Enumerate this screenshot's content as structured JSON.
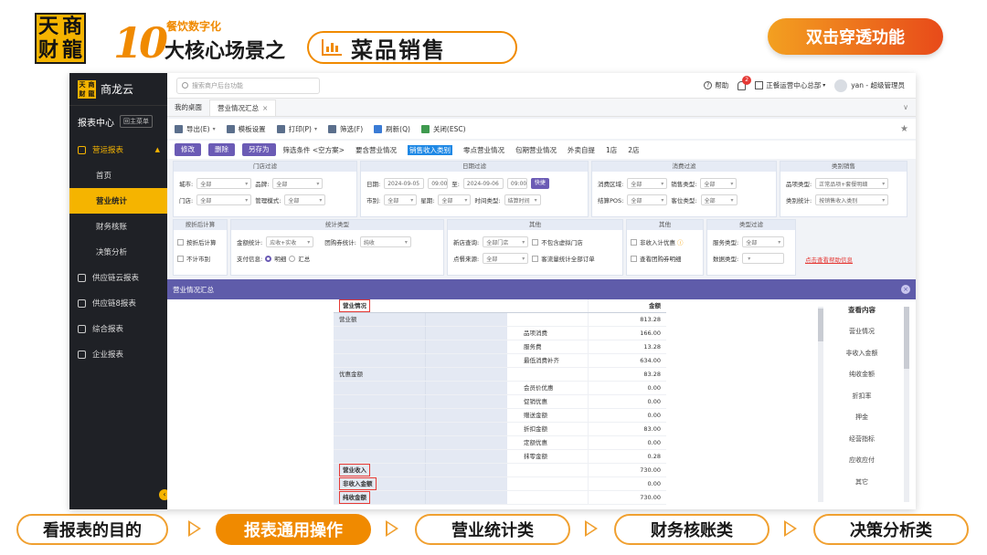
{
  "slide": {
    "logo_chars": [
      "天",
      "商",
      "财",
      "龍"
    ],
    "number": "10",
    "subtag": "餐饮数字化",
    "scene_title": "大核心场景之",
    "module_title": "菜品销售",
    "drill_badge": "双击穿透功能",
    "accent_color": "#f08a00"
  },
  "sidebar": {
    "brand": "商龙云",
    "brand_mini": [
      "天",
      "商",
      "财",
      "龍"
    ],
    "section": "报表中心",
    "back_label": "回主菜单",
    "group": "营运报表",
    "group_items": [
      {
        "label": "首页"
      },
      {
        "label": "营业统计"
      },
      {
        "label": "财务核账"
      },
      {
        "label": "决策分析"
      }
    ],
    "other_items": [
      {
        "label": "供应链云报表"
      },
      {
        "label": "供应链8报表"
      },
      {
        "label": "综合报表"
      },
      {
        "label": "企业报表"
      }
    ],
    "active_color": "#f5b400"
  },
  "topbar": {
    "search_placeholder": "搜索商户后台功能",
    "help": "帮助",
    "notifications": "2",
    "org": "正餐运营中心总部",
    "user": "yan - 超级管理员"
  },
  "tabs": [
    {
      "label": "我的桌面"
    },
    {
      "label": "营业情况汇总"
    }
  ],
  "toolbar": {
    "export": "导出(E)",
    "template": "模板设置",
    "print": "打印(P)",
    "filter": "筛选(F)",
    "refresh": "刷新(Q)",
    "close": "关闭(ESC)"
  },
  "filter_bar": {
    "modify": "修改",
    "delete": "删除",
    "save_as": "另存为",
    "items": [
      "筛选条件 <空方案>",
      "要含营业情况",
      "销售收入类别",
      "零点营业情况",
      "包期营业情况",
      "外卖自提",
      "1店",
      "2店"
    ]
  },
  "store_filter": {
    "title": "门店过滤",
    "city_label": "城市:",
    "city": "全部",
    "brand_label": "品牌:",
    "brand": "全部",
    "store_label": "门店:",
    "store": "全部",
    "mgmt_label": "管理模式:",
    "mgmt": "全部"
  },
  "date_filter": {
    "title": "日期过滤",
    "date_label": "日期:",
    "date_from": "2024-09-05",
    "time_from": "09:00",
    "to_label": "至:",
    "date_to": "2024-09-06",
    "time_to": "09:00",
    "quick": "快捷",
    "market_label": "市别:",
    "market": "全部",
    "week_label": "星期:",
    "week": "全部",
    "time_type_label": "时间类型:",
    "time_type": "结算时间"
  },
  "consume_filter": {
    "title": "消费过滤",
    "area_label": "消费区域:",
    "area": "全部",
    "sale_type_label": "销售类型:",
    "sale_type": "全部",
    "pos_label": "结算POS:",
    "pos": "全部",
    "guest_type_label": "客位类型:",
    "guest_type": "全部"
  },
  "category_sales": {
    "title": "类别销售",
    "item_type_label": "品项类型:",
    "item_type": "正常品项+套餐明细",
    "cat_stat_label": "类别统计:",
    "cat_stat": "按销售收入类别"
  },
  "discount_calc": {
    "title": "按折后计算",
    "opt1": "按折后计算",
    "opt2": "不计市别"
  },
  "stat_type": {
    "title": "统计类型",
    "amount_label": "金额统计:",
    "amount": "应收+实收",
    "group_coupon_label": "团购券统计:",
    "group_coupon": "纯收",
    "pay_label": "支付信息:",
    "detail": "明细",
    "summary": "汇总"
  },
  "other_filter": {
    "title": "其他",
    "new_store_label": "新店查询:",
    "new_store": "全部门店",
    "exclude_virtual": "不包含虚拟门店",
    "source_label": "点餐来源:",
    "source": "全部",
    "guest_stats": "客流量统计全部订单"
  },
  "other_filter2": {
    "title": "其他",
    "non_income": "非收入计优惠",
    "view_group_coupon": "查看团购券明细"
  },
  "type_filter": {
    "title": "类型过滤",
    "service_label": "服务类型:",
    "service": "全部",
    "data_label": "数据类型:",
    "data": ""
  },
  "help_link": "点击查看帮助信息",
  "report": {
    "title": "营业情况汇总",
    "header_item": "营业情况",
    "header_amount": "金额",
    "rows": [
      {
        "c1": "营业额",
        "c3": "",
        "amount": "813.28"
      },
      {
        "c1": "",
        "c3": "品项消费",
        "amount": "166.00"
      },
      {
        "c1": "",
        "c3": "服务费",
        "amount": "13.28"
      },
      {
        "c1": "",
        "c3": "最低消费补齐",
        "amount": "634.00"
      },
      {
        "c1": "优惠金额",
        "c3": "",
        "amount": "83.28"
      },
      {
        "c1": "",
        "c3": "会员价优惠",
        "amount": "0.00"
      },
      {
        "c1": "",
        "c3": "促销优惠",
        "amount": "0.00"
      },
      {
        "c1": "",
        "c3": "赠送金额",
        "amount": "0.00"
      },
      {
        "c1": "",
        "c3": "折扣金额",
        "amount": "83.00"
      },
      {
        "c1": "",
        "c3": "定额优惠",
        "amount": "0.00"
      },
      {
        "c1": "",
        "c3": "抹零金额",
        "amount": "0.28"
      },
      {
        "c1": "营业收入",
        "c3": "",
        "amount": "730.00",
        "boxed": true
      },
      {
        "c1": "非收入金额",
        "c3": "",
        "amount": "0.00",
        "boxed": true
      },
      {
        "c1": "纯收金额",
        "c3": "",
        "amount": "730.00",
        "boxed": true
      }
    ],
    "view_title": "查看内容",
    "view_items": [
      "营业情况",
      "非收入金额",
      "纯收金额",
      "折扣率",
      "押金",
      "经营指标",
      "应收应付",
      "其它"
    ]
  },
  "bottom_nav": [
    {
      "label": "看报表的目的"
    },
    {
      "label": "报表通用操作"
    },
    {
      "label": "营业统计类"
    },
    {
      "label": "财务核账类"
    },
    {
      "label": "决策分析类"
    }
  ]
}
